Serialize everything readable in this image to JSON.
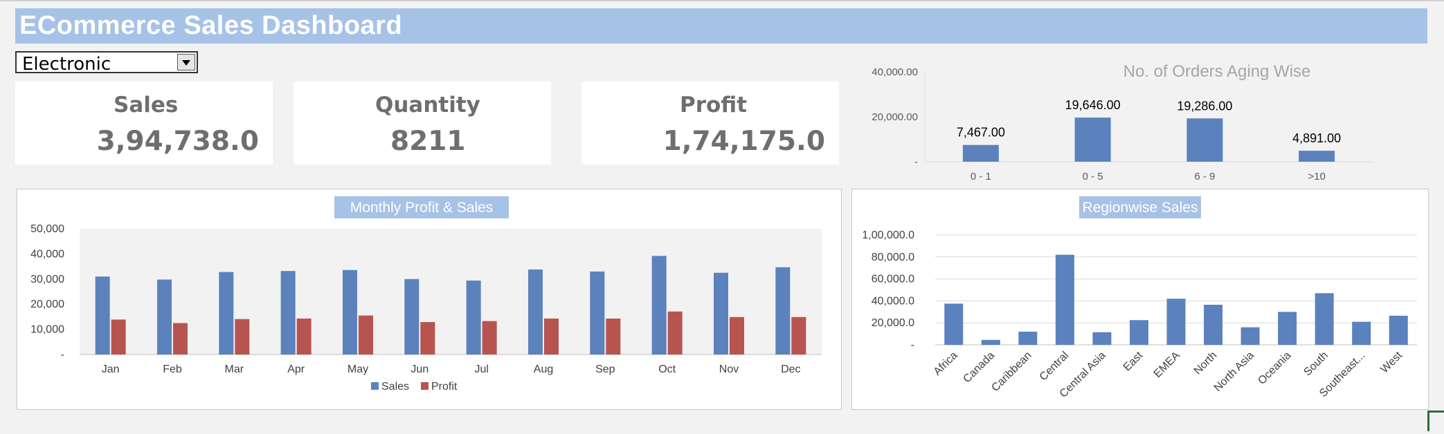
{
  "header": {
    "title": "ECommerce Sales Dashboard"
  },
  "filter": {
    "selected": "Electronic"
  },
  "kpis": {
    "sales": {
      "label": "Sales",
      "value": "3,94,738.0"
    },
    "quantity": {
      "label": "Quantity",
      "value": "8211"
    },
    "profit": {
      "label": "Profit",
      "value": "1,74,175.0"
    }
  },
  "colors": {
    "sales": "#5b82bd",
    "profit": "#b85450",
    "title_bar": "#a6c2e6"
  },
  "chart_data": [
    {
      "id": "aging",
      "type": "bar",
      "title": "No. of Orders Aging Wise",
      "categories": [
        "0 - 1",
        "0 - 5",
        "6 - 9",
        ">10"
      ],
      "values": [
        7467,
        19646,
        19286,
        4891
      ],
      "data_labels": [
        "7,467.00",
        "19,646.00",
        "19,286.00",
        "4,891.00"
      ],
      "ylim": [
        0,
        40000
      ],
      "yticks": [
        0,
        20000,
        40000
      ],
      "ytick_labels": [
        "-",
        "20,000.00",
        "40,000.00"
      ],
      "grid": false
    },
    {
      "id": "monthly",
      "type": "bar",
      "title": "Monthly Profit & Sales",
      "categories": [
        "Jan",
        "Feb",
        "Mar",
        "Apr",
        "May",
        "Jun",
        "Jul",
        "Aug",
        "Sep",
        "Oct",
        "Nov",
        "Dec"
      ],
      "series": [
        {
          "name": "Sales",
          "values": [
            31000,
            29800,
            32800,
            33200,
            33600,
            30000,
            29400,
            33800,
            33000,
            39200,
            32500,
            34700
          ]
        },
        {
          "name": "Profit",
          "values": [
            13900,
            12500,
            14100,
            14300,
            15500,
            12900,
            13300,
            14300,
            14300,
            17100,
            14900,
            14900
          ]
        }
      ],
      "ylim": [
        0,
        50000
      ],
      "yticks": [
        0,
        10000,
        20000,
        30000,
        40000,
        50000
      ],
      "ytick_labels": [
        "-",
        "10,000",
        "20,000",
        "30,000",
        "40,000",
        "50,000"
      ],
      "legend": "bottom",
      "grid": false
    },
    {
      "id": "regional",
      "type": "bar",
      "title": "Regionwise Sales",
      "categories": [
        "Africa",
        "Canada",
        "Caribbean",
        "Central",
        "Central Asia",
        "East",
        "EMEA",
        "North",
        "North Asia",
        "Oceania",
        "South",
        "Southeast...",
        "West"
      ],
      "values": [
        37500,
        4500,
        12000,
        82000,
        11500,
        22500,
        42000,
        36500,
        16000,
        30000,
        47000,
        21000,
        26500
      ],
      "ylim": [
        0,
        100000
      ],
      "yticks": [
        0,
        20000,
        40000,
        60000,
        80000,
        100000
      ],
      "ytick_labels": [
        "-",
        "20,000.0",
        "40,000.0",
        "60,000.0",
        "80,000.0",
        "1,00,000.0"
      ],
      "grid": true
    }
  ]
}
